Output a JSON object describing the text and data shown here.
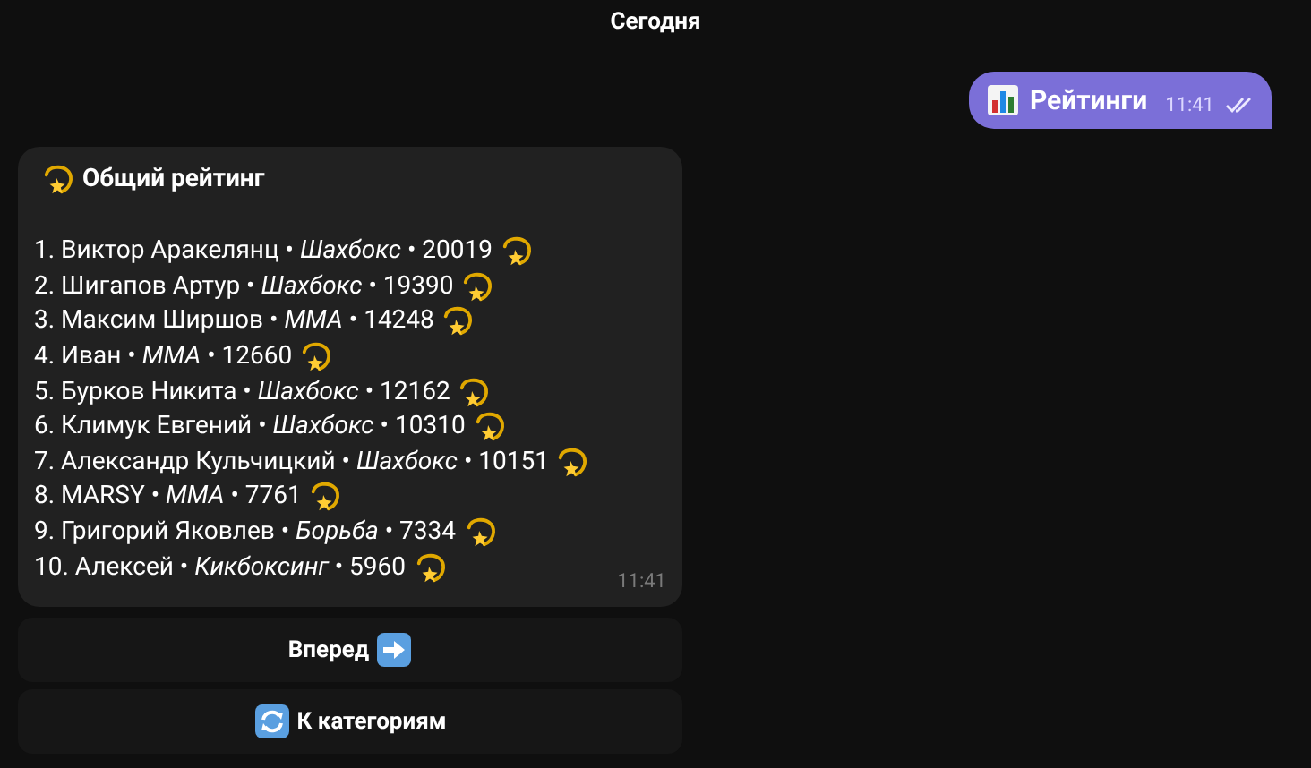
{
  "date_header": "Сегодня",
  "outgoing_message": {
    "text": "Рейтинги",
    "time": "11:41",
    "read": true
  },
  "incoming_message": {
    "title": "Общий рейтинг",
    "time": "11:41",
    "lines": [
      "1. Виктор Аракелянц • *Шахбокс* • 20019",
      "2. Шигапов Артур • *Шахбокс* • 19390",
      "3. Максим Ширшов • *ММА* • 14248",
      "4. Иван • *ММА* • 12660",
      "5. Бурков Никита • *Шахбокс* • 12162",
      "6. Климук Евгений • *Шахбокс* • 10310",
      "7. Александр Кульчицкий • *Шахбокс* • 10151",
      "8. MARSY • *ММА* • 7761",
      "9. Григорий Яковлев • *Борьба* • 7334",
      "10. Алексей • *Кикбоксинг* • 5960"
    ]
  },
  "inline_buttons": [
    {
      "label": "Вперед",
      "kind": "forward"
    },
    {
      "label": "К категориям",
      "kind": "categories"
    }
  ]
}
